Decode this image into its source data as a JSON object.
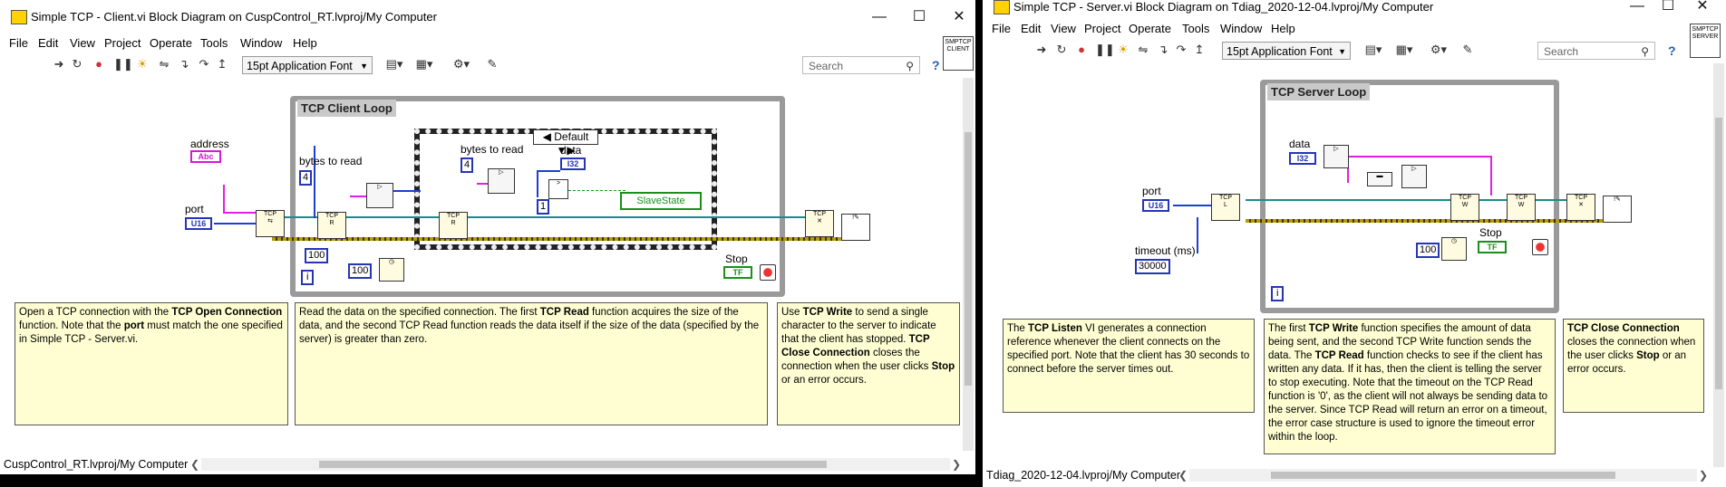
{
  "client": {
    "title": "Simple TCP - Client.vi Block Diagram on CuspControl_RT.lvproj/My Computer",
    "menu": [
      "File",
      "Edit",
      "View",
      "Project",
      "Operate",
      "Tools",
      "Window",
      "Help"
    ],
    "font_select": "15pt Application Font",
    "search_placeholder": "Search",
    "connpane_label": "SMPTCP CLIENT",
    "loop_label": "TCP Client Loop",
    "case_selector": "Default",
    "labels": {
      "address": "address",
      "port": "port",
      "bytes_to_read_1": "bytes to read",
      "bytes_to_read_2": "bytes to read",
      "data": "data",
      "stop": "Stop"
    },
    "consts": {
      "four_a": "4",
      "four_b": "4",
      "hundred_a": "100",
      "hundred_b": "100",
      "one": "1",
      "i": "i"
    },
    "terminals": {
      "abc": "Abc",
      "u16": "U16",
      "i32": "I32",
      "tf": "TF",
      "slavestate": "SlaveState"
    },
    "comments": {
      "c1": [
        {
          "t": "Open a TCP connection with the ",
          "b": false
        },
        {
          "t": "TCP Open Connection",
          "b": true
        },
        {
          "t": " function. Note that the ",
          "b": false
        },
        {
          "t": "port",
          "b": true
        },
        {
          "t": " must match the one specified in Simple TCP - Server.vi.",
          "b": false
        }
      ],
      "c2": [
        {
          "t": "Read the data on the specified connection. The first ",
          "b": false
        },
        {
          "t": "TCP Read",
          "b": true
        },
        {
          "t": " function acquires the size of the data, and the second TCP Read function reads the data itself if the size of the data (specified by the server) is greater than zero.",
          "b": false
        }
      ],
      "c3": [
        {
          "t": "Use ",
          "b": false
        },
        {
          "t": "TCP Write",
          "b": true
        },
        {
          "t": " to send a single character to the server to indicate that the client has stopped. ",
          "b": false
        },
        {
          "t": "TCP Close Connection",
          "b": true
        },
        {
          "t": " closes the connection when the user clicks ",
          "b": false
        },
        {
          "t": "Stop",
          "b": true
        },
        {
          "t": " or an error occurs.",
          "b": false
        }
      ]
    },
    "status": "CuspControl_RT.lvproj/My Computer"
  },
  "server": {
    "title": "Simple TCP - Server.vi Block Diagram on Tdiag_2020-12-04.lvproj/My Computer",
    "menu": [
      "File",
      "Edit",
      "View",
      "Project",
      "Operate",
      "Tools",
      "Window",
      "Help"
    ],
    "font_select": "15pt Application Font",
    "search_placeholder": "Search",
    "connpane_label": "SMPTCP SERVER",
    "loop_label": "TCP Server Loop",
    "labels": {
      "data": "data",
      "port": "port",
      "timeout": "timeout (ms)",
      "stop": "Stop"
    },
    "consts": {
      "timeout_val": "30000",
      "hundred": "100",
      "i": "i"
    },
    "terminals": {
      "i32": "I32",
      "u16": "U16",
      "tf": "TF"
    },
    "comments": {
      "c1": [
        {
          "t": "The ",
          "b": false
        },
        {
          "t": "TCP Listen",
          "b": true
        },
        {
          "t": " VI generates a connection reference whenever the client connects on the specified port. Note that the client has 30 seconds to connect before the server times out.",
          "b": false
        }
      ],
      "c2": [
        {
          "t": "The first ",
          "b": false
        },
        {
          "t": "TCP Write",
          "b": true
        },
        {
          "t": " function specifies the amount of data being sent, and the second TCP Write function sends the data.  The ",
          "b": false
        },
        {
          "t": "TCP Read",
          "b": true
        },
        {
          "t": " function checks to see if the client has written any data. If it has, then the client is telling the server to stop executing. Note that the timeout on the TCP Read function is '0', as the client will not always be sending data to the server. Since TCP Read will return an error on a timeout, the error case structure is used to ignore the timeout error within the loop.",
          "b": false
        }
      ],
      "c3": [
        {
          "t": "TCP Close Connection",
          "b": true
        },
        {
          "t": " closes the connection when the user clicks ",
          "b": false
        },
        {
          "t": "Stop",
          "b": true
        },
        {
          "t": " or an error occurs.",
          "b": false
        }
      ]
    },
    "status": "Tdiag_2020-12-04.lvproj/My Computer"
  },
  "colors": {
    "comment_bg": "#fefed2",
    "int_wire": "#1e3fd1",
    "string_wire": "#e020e0",
    "ref_wire": "#1a8c8c",
    "error_wire": "#b59a00",
    "bool_wire": "#1a9a1a"
  }
}
